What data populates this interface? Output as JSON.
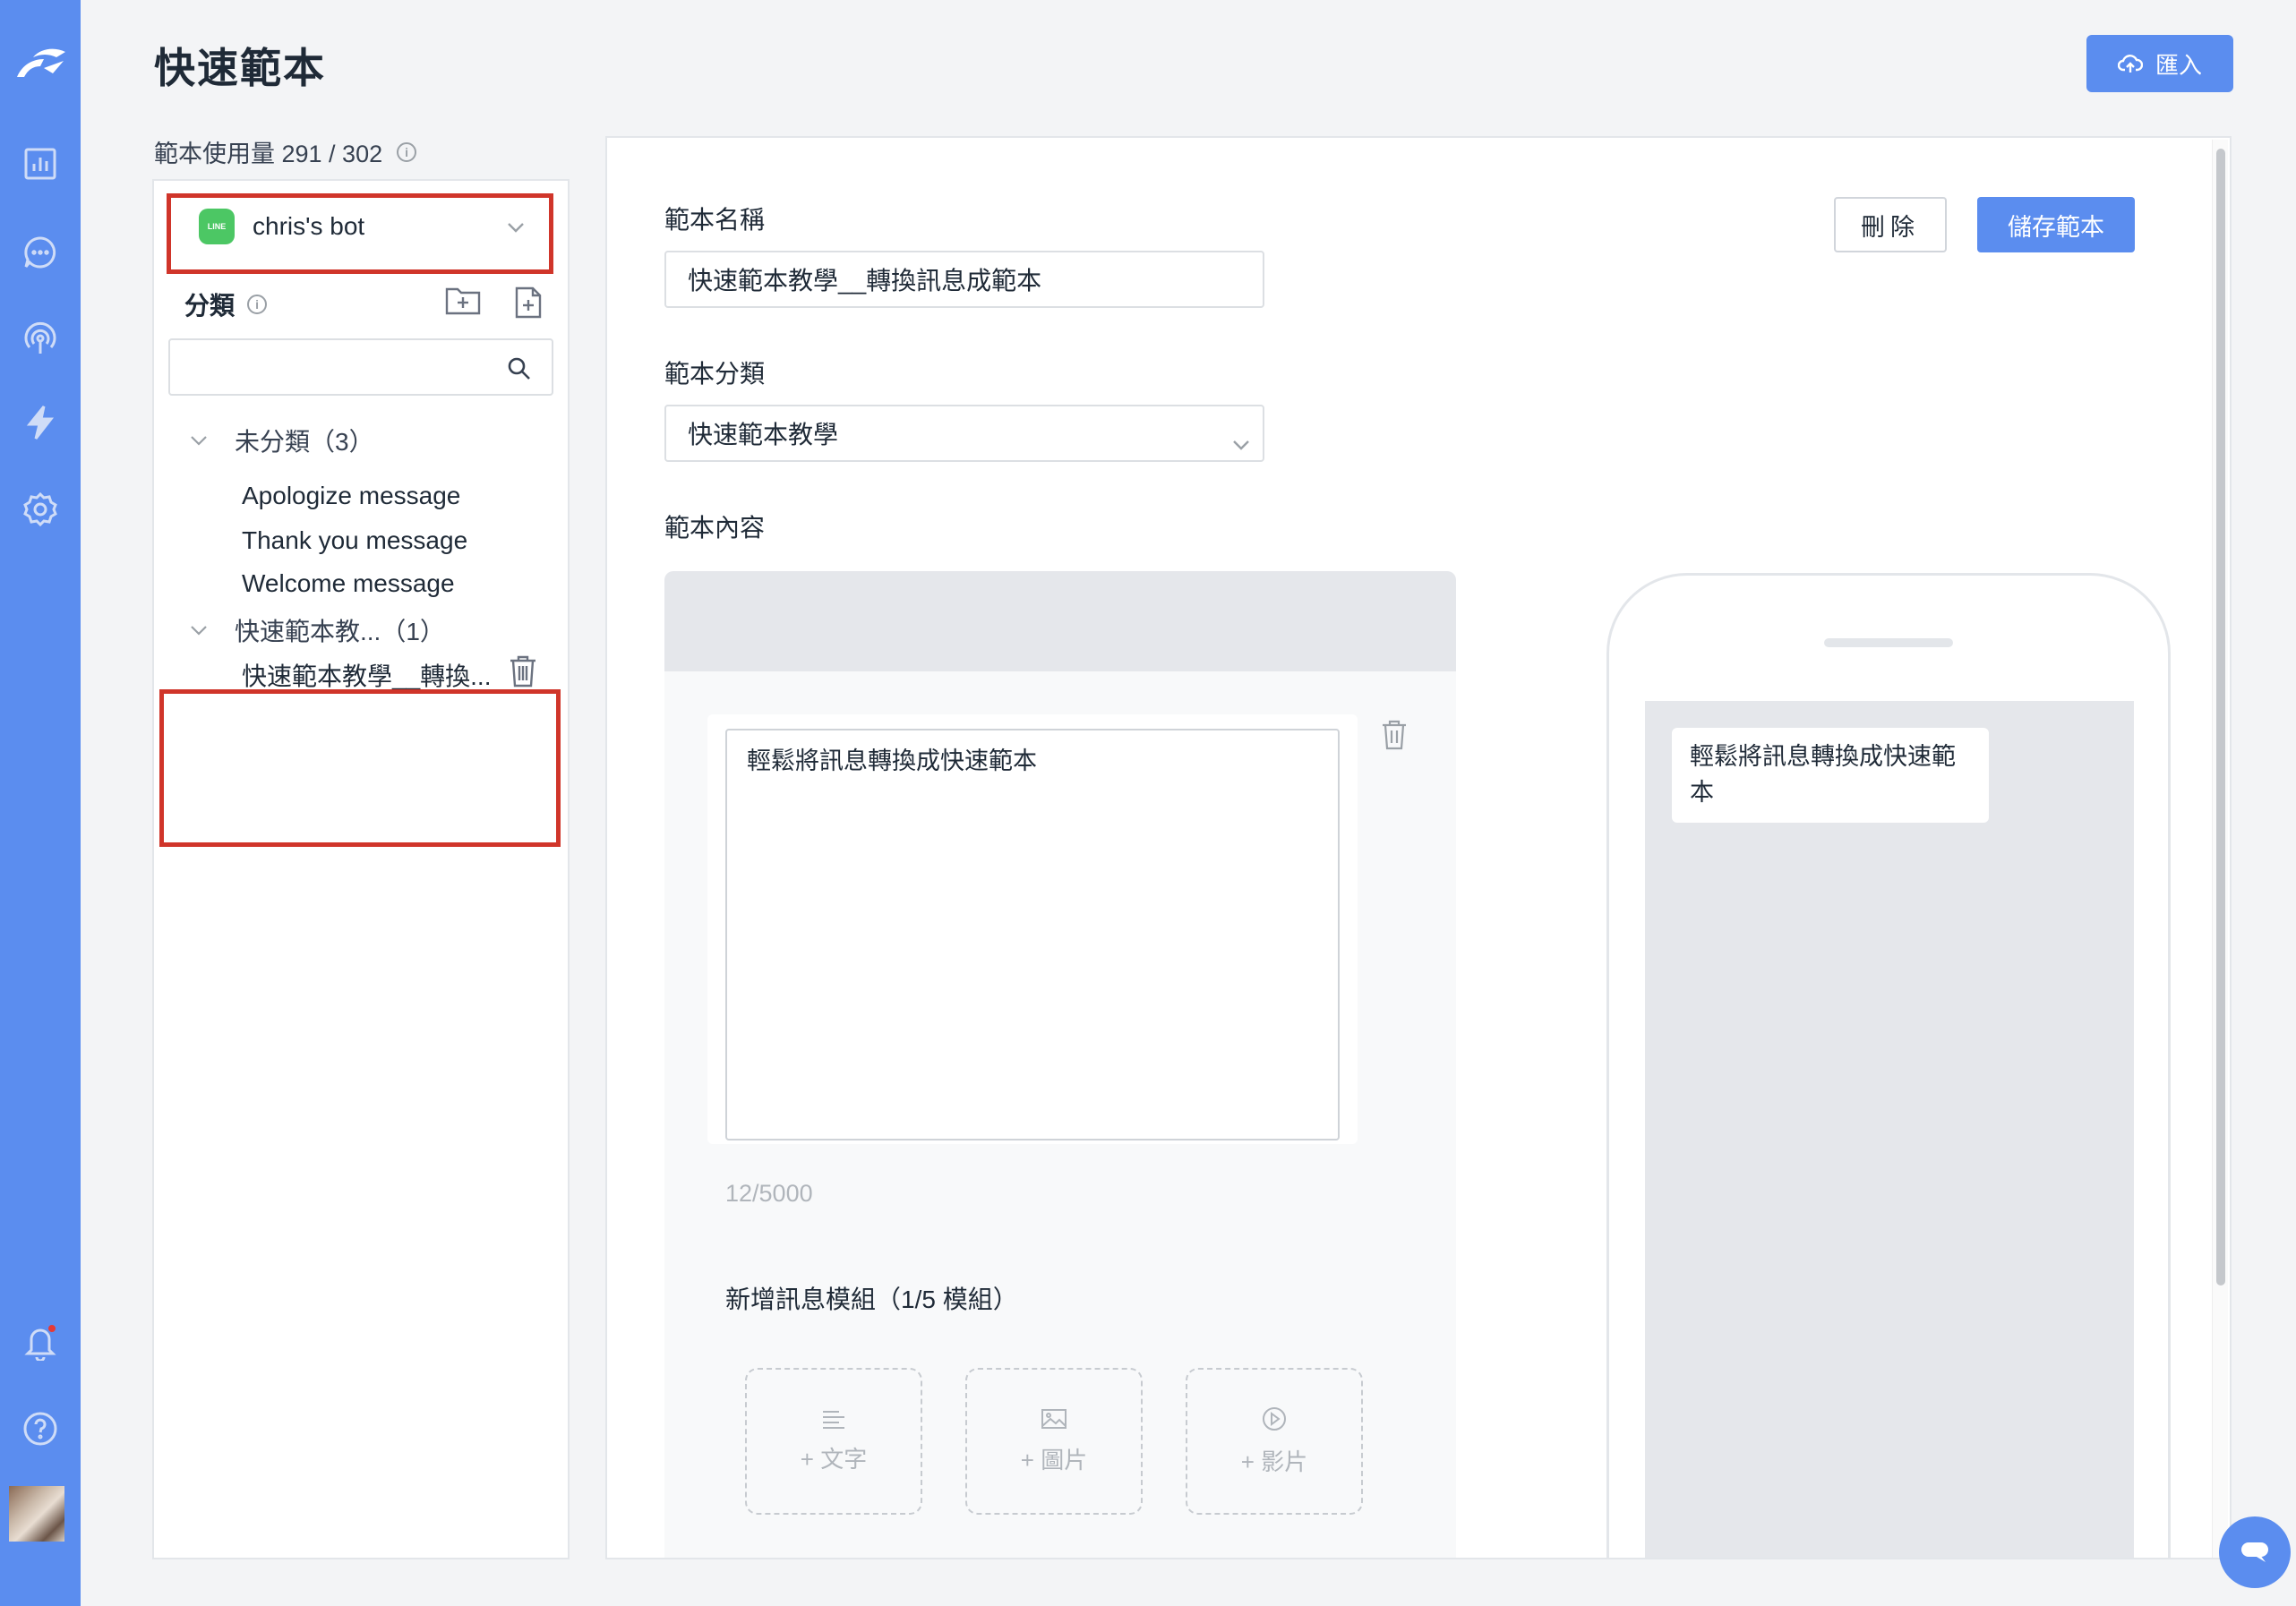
{
  "page": {
    "title": "快速範本",
    "import_label": "匯入",
    "usage_label": "範本使用量 291 / 302"
  },
  "left": {
    "bot_name": "chris's bot",
    "line_badge": "LINE",
    "category_label": "分類",
    "search_placeholder": "",
    "groups": [
      {
        "name": "未分類（3）",
        "items": [
          "Apologize message",
          "Thank you message",
          "Welcome message"
        ]
      },
      {
        "name": "快速範本教...（1）",
        "items": [
          "快速範本教學__轉換..."
        ]
      }
    ]
  },
  "form": {
    "name_label": "範本名稱",
    "name_value": "快速範本教學__轉換訊息成範本",
    "category_label": "範本分類",
    "category_value": "快速範本教學",
    "content_label": "範本內容",
    "delete_label": "刪除",
    "save_label": "儲存範本",
    "message_text": "輕鬆將訊息轉換成快速範本",
    "char_count": "12/5000",
    "add_module_label": "新增訊息模組（1/5 模組）",
    "add_text": "+ 文字",
    "add_image": "+ 圖片",
    "add_video": "+ 影片"
  },
  "preview": {
    "bubble_text": "輕鬆將訊息轉換成快速範本"
  },
  "colors": {
    "rail": "#5b8def",
    "primary": "#5b8def",
    "highlight": "#d0352a",
    "line_green": "#4cc764"
  },
  "icons": {
    "logo": "brand-logo",
    "dashboard": "bar-chart-icon",
    "chat": "chat-bubble-icon",
    "broadcast": "broadcast-icon",
    "automation": "lightning-icon",
    "settings": "gear-icon",
    "notifications": "bell-icon",
    "help": "help-icon"
  }
}
